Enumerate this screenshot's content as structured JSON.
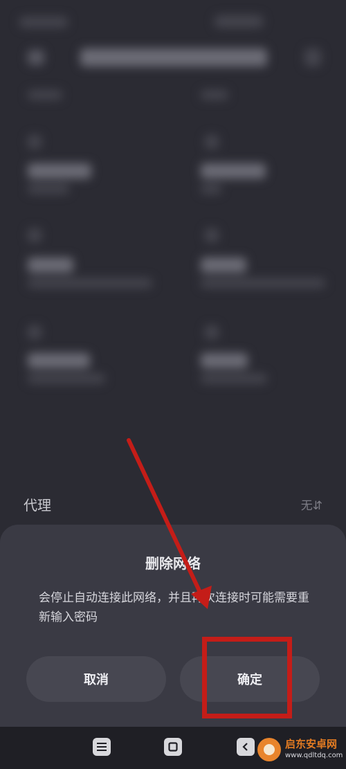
{
  "proxy": {
    "label": "代理",
    "value": "无"
  },
  "dialog": {
    "title": "删除网络",
    "message": "会停止自动连接此网络，并且再次连接时可能需要重新输入密码",
    "cancel_label": "取消",
    "confirm_label": "确定"
  },
  "navbar": {
    "icons": [
      "menu-icon",
      "home-icon",
      "back-icon"
    ]
  },
  "watermark": {
    "brand": "启东安卓网",
    "url": "www.qdltdq.com"
  },
  "colors": {
    "background": "#2b2b33",
    "sheet": "#3a3a44",
    "annotation": "#c41d18",
    "brand": "#e27b22"
  }
}
